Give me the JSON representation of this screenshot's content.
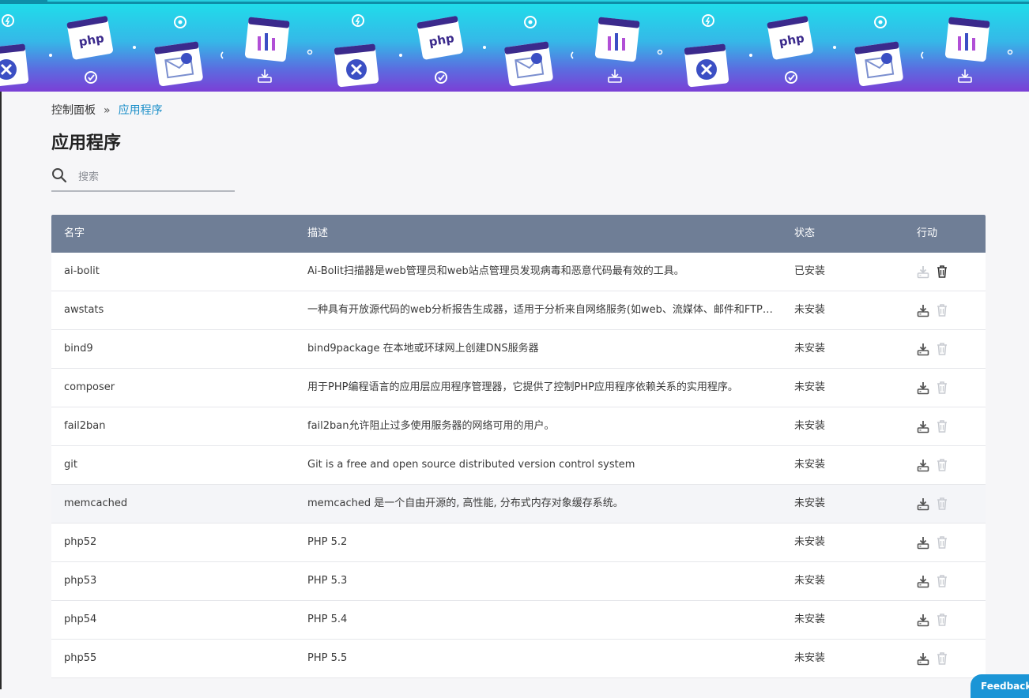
{
  "breadcrumb": {
    "home": "控制面板",
    "separator": "»",
    "current": "应用程序"
  },
  "page_title": "应用程序",
  "search": {
    "placeholder": "搜索",
    "value": ""
  },
  "table": {
    "headers": [
      "名字",
      "描述",
      "状态",
      "行动"
    ],
    "rows": [
      {
        "name": "ai-bolit",
        "desc": "Ai-Bolit扫描器是web管理员和web站点管理员发现病毒和恶意代码最有效的工具。",
        "status": "已安装",
        "installed": true
      },
      {
        "name": "awstats",
        "desc": "一种具有开放源代码的web分析报告生成器，适用于分析来自网络服务(如web、流媒体、邮件和FTP服务器)...",
        "status": "未安装",
        "installed": false
      },
      {
        "name": "bind9",
        "desc": "bind9package 在本地或环球网上创建DNS服务器",
        "status": "未安装",
        "installed": false
      },
      {
        "name": "composer",
        "desc": "用于PHP编程语言的应用层应用程序管理器，它提供了控制PHP应用程序依赖关系的实用程序。",
        "status": "未安装",
        "installed": false
      },
      {
        "name": "fail2ban",
        "desc": "fail2ban允许阻止过多使用服务器的网络可用的用户。",
        "status": "未安装",
        "installed": false
      },
      {
        "name": "git",
        "desc": "Git is a free and open source distributed version control system",
        "status": "未安装",
        "installed": false
      },
      {
        "name": "memcached",
        "desc": "memcached 是一个自由开源的, 高性能, 分布式内存对象缓存系统。",
        "status": "未安装",
        "installed": false
      },
      {
        "name": "php52",
        "desc": "PHP 5.2",
        "status": "未安装",
        "installed": false
      },
      {
        "name": "php53",
        "desc": "PHP 5.3",
        "status": "未安装",
        "installed": false
      },
      {
        "name": "php54",
        "desc": "PHP 5.4",
        "status": "未安装",
        "installed": false
      },
      {
        "name": "php55",
        "desc": "PHP 5.5",
        "status": "未安装",
        "installed": false
      }
    ]
  },
  "feedback_label": "Feedback",
  "icons": {
    "search": "search-icon",
    "install": "install-icon",
    "delete": "trash-icon"
  },
  "colors": {
    "header_bg": "#6f7e96",
    "link": "#1b8fc9",
    "banner_top": "#1ee0ea",
    "banner_bottom": "#7b3fd6"
  }
}
